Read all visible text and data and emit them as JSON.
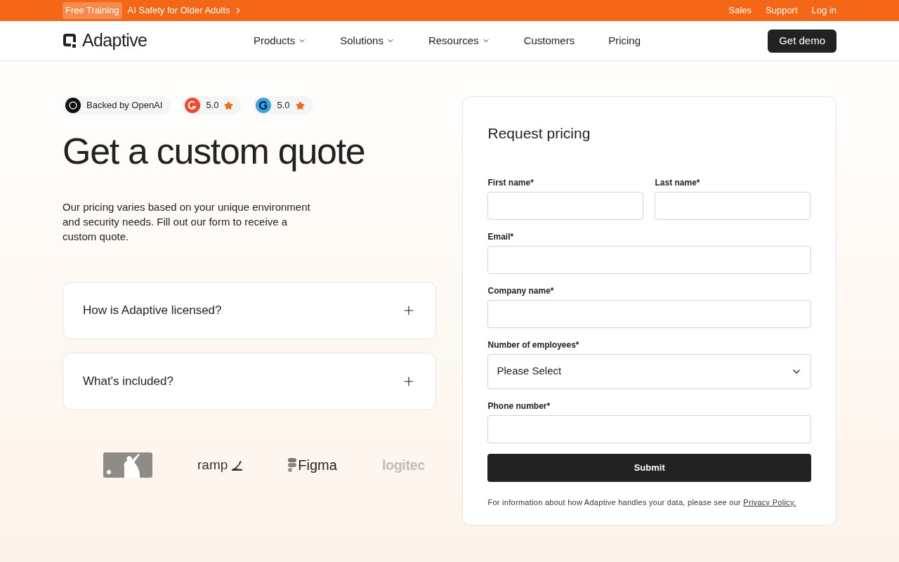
{
  "announcement": {
    "badge": "Free Training",
    "text": "AI Safety for Older Adults",
    "links": [
      "Sales",
      "Support",
      "Log in"
    ]
  },
  "nav": {
    "logo": "Adaptive",
    "items": [
      {
        "label": "Products",
        "dropdown": true
      },
      {
        "label": "Solutions",
        "dropdown": true
      },
      {
        "label": "Resources",
        "dropdown": true
      },
      {
        "label": "Customers",
        "dropdown": false
      },
      {
        "label": "Pricing",
        "dropdown": false
      }
    ],
    "cta": "Get demo"
  },
  "badges": [
    {
      "kind": "openai",
      "text": "Backed by OpenAI"
    },
    {
      "kind": "g2",
      "text": "5.0"
    },
    {
      "kind": "capterra",
      "text": "5.0"
    }
  ],
  "hero": {
    "title": "Get a custom quote",
    "description": "Our pricing varies based on your unique environment and security needs. Fill out our form to receive a custom quote."
  },
  "faq": [
    {
      "question": "How is Adaptive licensed?",
      "expanded": false
    },
    {
      "question": "What's included?",
      "expanded": false
    }
  ],
  "logos": [
    {
      "kind": "mlb"
    },
    {
      "kind": "ramp",
      "text": "ramp"
    },
    {
      "kind": "figma",
      "text": "Figma"
    },
    {
      "kind": "logitech",
      "text": "logitec"
    }
  ],
  "form": {
    "title": "Request pricing",
    "fields": [
      {
        "kind": "text",
        "label": "First name*",
        "half": true
      },
      {
        "kind": "text",
        "label": "Last name*",
        "half": true
      },
      {
        "kind": "text",
        "label": "Email*",
        "half": false
      },
      {
        "kind": "text",
        "label": "Company name*",
        "half": false
      },
      {
        "kind": "select",
        "label": "Number of employees*",
        "half": false,
        "value": "Please Select"
      },
      {
        "kind": "text",
        "label": "Phone number*",
        "half": false
      }
    ],
    "submit": "Submit",
    "disclaimer": "For information about how Adaptive handles your data, please see our",
    "privacy_link": "Privacy Policy."
  }
}
